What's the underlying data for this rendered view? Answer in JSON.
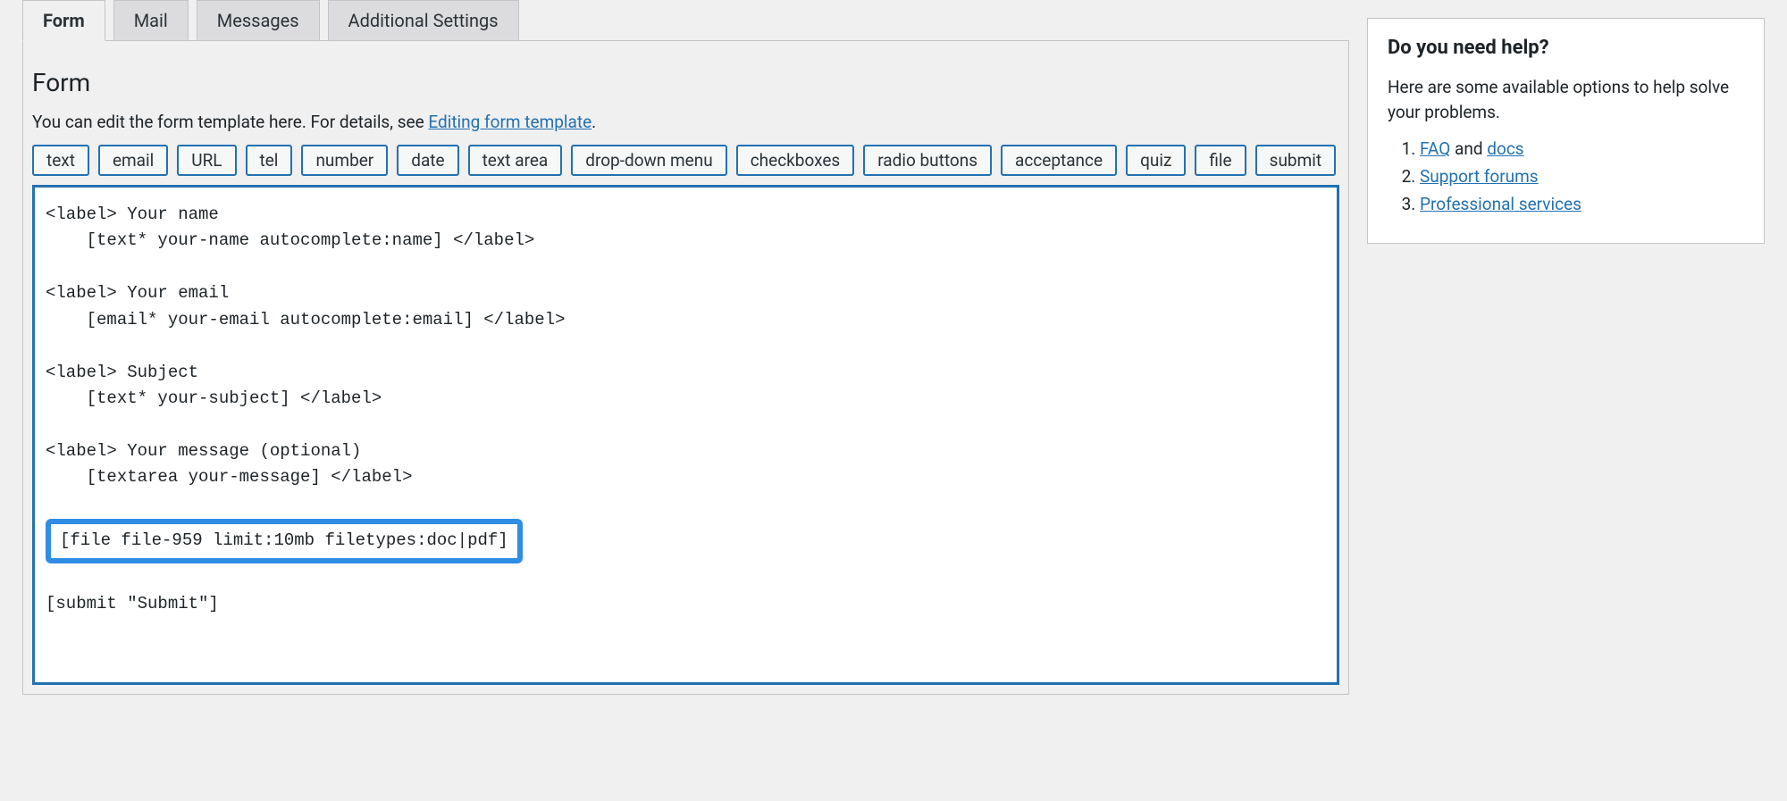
{
  "tabs": {
    "form": "Form",
    "mail": "Mail",
    "messages": "Messages",
    "additional": "Additional Settings"
  },
  "panel": {
    "title": "Form",
    "desc_pre": "You can edit the form template here. For details, see ",
    "desc_link": "Editing form template",
    "desc_post": "."
  },
  "tag_buttons": [
    "text",
    "email",
    "URL",
    "tel",
    "number",
    "date",
    "text area",
    "drop-down menu",
    "checkboxes",
    "radio buttons",
    "acceptance",
    "quiz",
    "file",
    "submit"
  ],
  "code": {
    "line1": "<label> Your name",
    "line2": "    [text* your-name autocomplete:name] </label>",
    "line3": "<label> Your email",
    "line4": "    [email* your-email autocomplete:email] </label>",
    "line5": "<label> Subject",
    "line6": "    [text* your-subject] </label>",
    "line7": "<label> Your message (optional)",
    "line8": "    [textarea your-message] </label>",
    "highlight": "[file file-959 limit:10mb filetypes:doc|pdf]",
    "line9": "[submit \"Submit\"]"
  },
  "sidebar": {
    "title": "Do you need help?",
    "intro": "Here are some available options to help solve your problems.",
    "faq_link": "FAQ",
    "faq_and": " and ",
    "docs_link": "docs",
    "support_link": "Support forums",
    "pro_link": "Professional services"
  }
}
